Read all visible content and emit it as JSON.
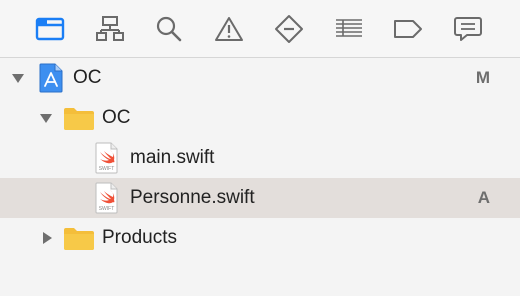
{
  "toolbar": {
    "buttons": [
      {
        "name": "project-navigator-icon",
        "active": true
      },
      {
        "name": "symbol-navigator-icon"
      },
      {
        "name": "find-navigator-icon"
      },
      {
        "name": "issue-navigator-icon"
      },
      {
        "name": "test-navigator-icon"
      },
      {
        "name": "debug-navigator-icon"
      },
      {
        "name": "breakpoint-navigator-icon"
      },
      {
        "name": "report-navigator-icon"
      }
    ],
    "active_color": "#1a7ef5",
    "icon_color": "#6b6b6b"
  },
  "tree": {
    "project": {
      "label": "OC",
      "status": "M",
      "expanded": true,
      "icon": "xcode-project-icon"
    },
    "group": {
      "label": "OC",
      "expanded": true,
      "icon": "folder-icon"
    },
    "files": [
      {
        "label": "main.swift",
        "status": "",
        "icon": "swift-file-icon",
        "icon_caption": "SWIFT"
      },
      {
        "label": "Personne.swift",
        "status": "A",
        "icon": "swift-file-icon",
        "icon_caption": "SWIFT",
        "selected": true
      }
    ],
    "products": {
      "label": "Products",
      "expanded": false,
      "icon": "folder-icon"
    }
  },
  "colors": {
    "folder": "#f7c948",
    "selection": "#e3dedb",
    "swift_accent": "#f05138"
  }
}
